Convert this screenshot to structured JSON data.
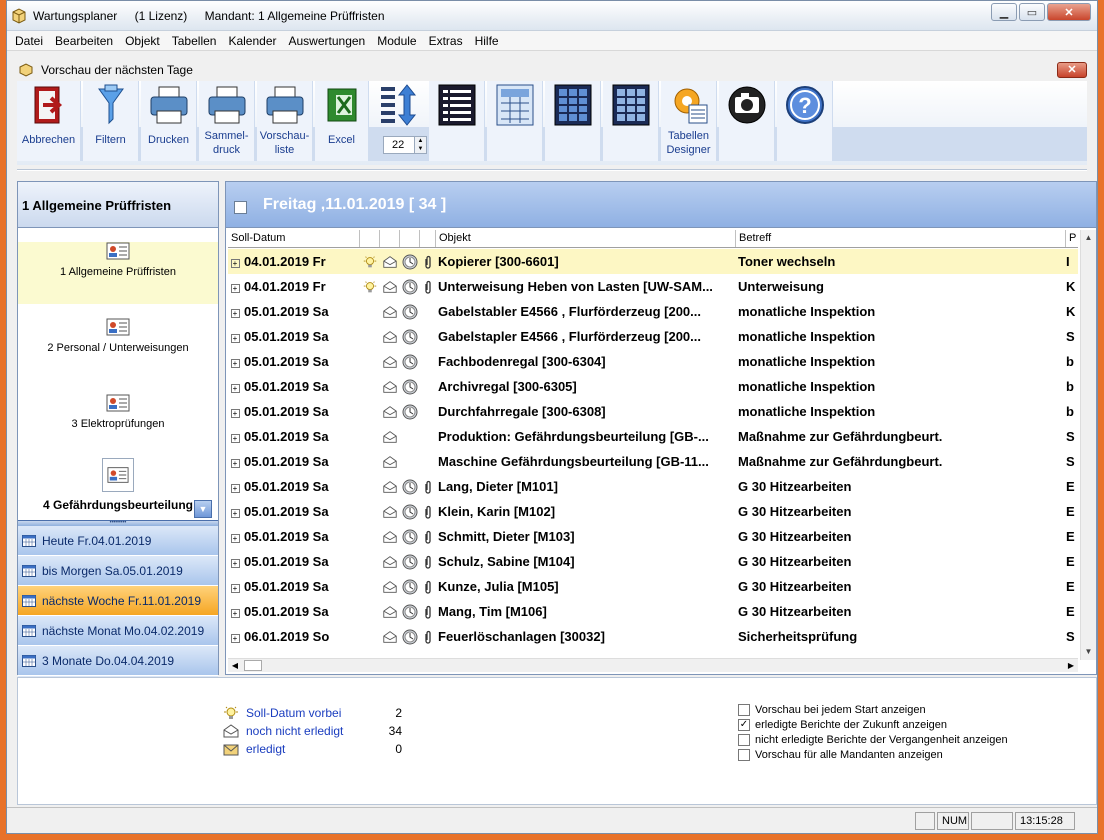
{
  "window": {
    "app_name": "Wartungsplaner",
    "license": "(1 Lizenz)",
    "mandant": "Mandant: 1 Allgemeine Prüffristen"
  },
  "menu": [
    "Datei",
    "Bearbeiten",
    "Objekt",
    "Tabellen",
    "Kalender",
    "Auswertungen",
    "Module",
    "Extras",
    "Hilfe"
  ],
  "subwindow": {
    "title": "Vorschau der nächsten Tage",
    "close": "✕"
  },
  "toolbar": {
    "abbrechen": "Abbrechen",
    "filtern": "Filtern",
    "drucken": "Drucken",
    "sammel1": "Sammel-",
    "sammel2": "druck",
    "vorschau1": "Vorschau-",
    "vorschau2": "liste",
    "excel": "Excel",
    "days": "22",
    "tabellen1": "Tabellen",
    "tabellen2": "Designer"
  },
  "left": {
    "header": "1 Allgemeine Prüffristen",
    "items": [
      "1 Allgemeine Prüffristen",
      "2 Personal / Unterweisungen",
      "3 Elektroprüfungen",
      "4 Gefährdungsbeurteilung"
    ],
    "dates": [
      "Heute Fr.04.01.2019",
      "bis Morgen Sa.05.01.2019",
      "nächste Woche Fr.11.01.2019",
      "nächste Monat Mo.04.02.2019",
      "3 Monate Do.04.04.2019"
    ]
  },
  "main": {
    "title": "Freitag ,11.01.2019  [ 34 ]",
    "columns": [
      "Soll-Datum",
      "",
      "",
      "",
      "Objekt",
      "Betreff",
      "P"
    ],
    "rows": [
      {
        "date": "04.01.2019 Fr",
        "icons": [
          "bulb",
          "env-open",
          "clock",
          "clip"
        ],
        "obj": "Kopierer [300-6601]",
        "bet": "Toner wechseln",
        "r": "I"
      },
      {
        "date": "04.01.2019 Fr",
        "icons": [
          "bulb",
          "env-open",
          "clock",
          "clip"
        ],
        "obj": "Unterweisung Heben von Lasten [UW-SAM...",
        "bet": "Unterweisung",
        "r": "K"
      },
      {
        "date": "05.01.2019 Sa",
        "icons": [
          "",
          "env-open",
          "clock",
          ""
        ],
        "obj": "Gabelstabler E4566 , Flurförderzeug [200...",
        "bet": "monatliche Inspektion",
        "r": "K"
      },
      {
        "date": "05.01.2019 Sa",
        "icons": [
          "",
          "env-open",
          "clock",
          ""
        ],
        "obj": "Gabelstapler E4566 , Flurförderzeug [200...",
        "bet": "monatliche Inspektion",
        "r": "S"
      },
      {
        "date": "05.01.2019 Sa",
        "icons": [
          "",
          "env-open",
          "clock",
          ""
        ],
        "obj": "Fachbodenregal [300-6304]",
        "bet": "monatliche Inspektion",
        "r": "b"
      },
      {
        "date": "05.01.2019 Sa",
        "icons": [
          "",
          "env-open",
          "clock",
          ""
        ],
        "obj": "Archivregal [300-6305]",
        "bet": "monatliche Inspektion",
        "r": "b"
      },
      {
        "date": "05.01.2019 Sa",
        "icons": [
          "",
          "env-open",
          "clock",
          ""
        ],
        "obj": "Durchfahrregale [300-6308]",
        "bet": "monatliche Inspektion",
        "r": "b"
      },
      {
        "date": "05.01.2019 Sa",
        "icons": [
          "",
          "env-open",
          "",
          ""
        ],
        "obj": "Produktion: Gefährdungsbeurteilung [GB-...",
        "bet": "Maßnahme zur Gefährdungbeurt.",
        "r": "S"
      },
      {
        "date": "05.01.2019 Sa",
        "icons": [
          "",
          "env-open",
          "",
          ""
        ],
        "obj": "Maschine Gefährdungsbeurteilung [GB-11...",
        "bet": "Maßnahme zur Gefährdungbeurt.",
        "r": "S"
      },
      {
        "date": "05.01.2019 Sa",
        "icons": [
          "",
          "env-open",
          "clock",
          "clip"
        ],
        "obj": "Lang, Dieter [M101]",
        "bet": "G 30 Hitzearbeiten",
        "r": "E"
      },
      {
        "date": "05.01.2019 Sa",
        "icons": [
          "",
          "env-open",
          "clock",
          "clip"
        ],
        "obj": "Klein, Karin [M102]",
        "bet": "G 30 Hitzearbeiten",
        "r": "E"
      },
      {
        "date": "05.01.2019 Sa",
        "icons": [
          "",
          "env-open",
          "clock",
          "clip"
        ],
        "obj": "Schmitt, Dieter [M103]",
        "bet": "G 30 Hitzearbeiten",
        "r": "E"
      },
      {
        "date": "05.01.2019 Sa",
        "icons": [
          "",
          "env-open",
          "clock",
          "clip"
        ],
        "obj": "Schulz, Sabine [M104]",
        "bet": "G 30 Hitzearbeiten",
        "r": "E"
      },
      {
        "date": "05.01.2019 Sa",
        "icons": [
          "",
          "env-open",
          "clock",
          "clip"
        ],
        "obj": "Kunze, Julia [M105]",
        "bet": "G 30 Hitzearbeiten",
        "r": "E"
      },
      {
        "date": "05.01.2019 Sa",
        "icons": [
          "",
          "env-open",
          "clock",
          "clip"
        ],
        "obj": "Mang, Tim [M106]",
        "bet": "G 30 Hitzearbeiten",
        "r": "E"
      },
      {
        "date": "06.01.2019 So",
        "icons": [
          "",
          "env-open",
          "clock",
          "clip"
        ],
        "obj": "Feuerlöschanlagen [30032]",
        "bet": "Sicherheitsprüfung",
        "r": "S"
      }
    ]
  },
  "legend": [
    {
      "icon": "bulb",
      "label": "Soll-Datum vorbei",
      "count": "2"
    },
    {
      "icon": "env-open",
      "label": "noch nicht erledigt",
      "count": "34"
    },
    {
      "icon": "env-closed",
      "label": "erledigt",
      "count": "0"
    }
  ],
  "options": [
    {
      "label": "Vorschau bei jedem Start anzeigen",
      "checked": false
    },
    {
      "label": "erledigte Berichte der Zukunft anzeigen",
      "checked": true
    },
    {
      "label": "nicht erledigte Berichte der Vergangenheit anzeigen",
      "checked": false
    },
    {
      "label": "Vorschau für alle Mandanten anzeigen",
      "checked": false
    }
  ],
  "status": {
    "num": "NUM",
    "time": "13:15:28"
  },
  "colors": {
    "accent": "#8fb0e3",
    "active_date": "#f5a623",
    "first_row": "#fdf7c4"
  }
}
